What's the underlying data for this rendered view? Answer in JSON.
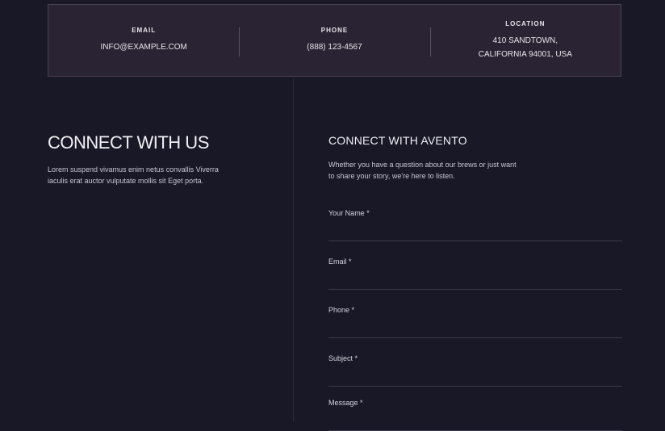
{
  "contact_info": [
    {
      "label": "EMAIL",
      "value": "INFO@EXAMPLE.COM"
    },
    {
      "label": "PHONE",
      "value": "(888) 123-4567"
    },
    {
      "label": "LOCATION",
      "value": "410 SANDTOWN,\nCALIFORNIA 94001, USA"
    }
  ],
  "left": {
    "title": "CONNECT WITH US",
    "text": "Lorem suspend vivamus enim netus convallis Viverra iaculis erat auctor vulputate mollis sit Eget porta."
  },
  "form": {
    "title": "CONNECT WITH AVENTO",
    "intro": "Whether you have a question about our brews or just want to share your story, we're here to listen.",
    "fields": [
      {
        "label": "Your Name *",
        "value": ""
      },
      {
        "label": "Email *",
        "value": ""
      },
      {
        "label": "Phone *",
        "value": ""
      },
      {
        "label": "Subject *",
        "value": ""
      },
      {
        "label": "Message *",
        "value": ""
      }
    ]
  }
}
